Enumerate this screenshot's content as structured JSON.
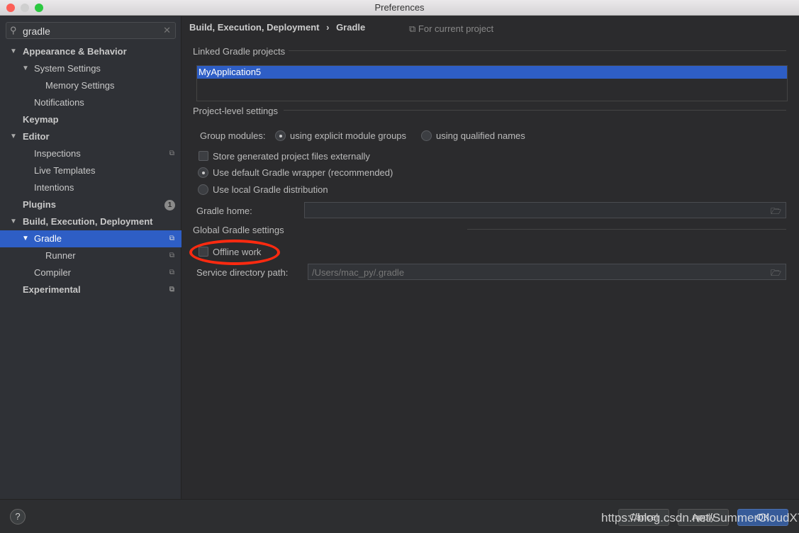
{
  "window": {
    "title": "Preferences"
  },
  "search": {
    "value": "gradle"
  },
  "sidebar": {
    "items": [
      {
        "label": "Appearance & Behavior"
      },
      {
        "label": "System Settings"
      },
      {
        "label": "Memory Settings"
      },
      {
        "label": "Notifications"
      },
      {
        "label": "Keymap"
      },
      {
        "label": "Editor"
      },
      {
        "label": "Inspections"
      },
      {
        "label": "Live Templates"
      },
      {
        "label": "Intentions"
      },
      {
        "label": "Plugins",
        "badge": "1"
      },
      {
        "label": "Build, Execution, Deployment"
      },
      {
        "label": "Gradle"
      },
      {
        "label": "Runner"
      },
      {
        "label": "Compiler"
      },
      {
        "label": "Experimental"
      }
    ]
  },
  "breadcrumb": {
    "parent": "Build, Execution, Deployment",
    "separator": "›",
    "current": "Gradle",
    "scope": "For current project"
  },
  "linked": {
    "title": "Linked Gradle projects",
    "projects": [
      "MyApplication5"
    ]
  },
  "project_level": {
    "title": "Project-level settings",
    "group_modules_label": "Group modules:",
    "option_explicit": "using explicit module groups",
    "option_qualified": "using qualified names",
    "store_external": "Store generated project files externally",
    "use_wrapper": "Use default Gradle wrapper (recommended)",
    "use_local": "Use local Gradle distribution",
    "gradle_home_label": "Gradle home:",
    "gradle_home_value": ""
  },
  "global": {
    "title": "Global Gradle settings",
    "offline": "Offline work",
    "service_dir_label": "Service directory path:",
    "service_dir_placeholder": "/Users/mac_py/.gradle"
  },
  "footer": {
    "help": "?",
    "cancel": "Cancel",
    "apply": "Apply",
    "ok": "OK"
  },
  "watermark": "https://blog.csdn.net/SummerCloudXT",
  "colors": {
    "selection": "#2e5ec5",
    "annotation": "#ff2a10"
  }
}
